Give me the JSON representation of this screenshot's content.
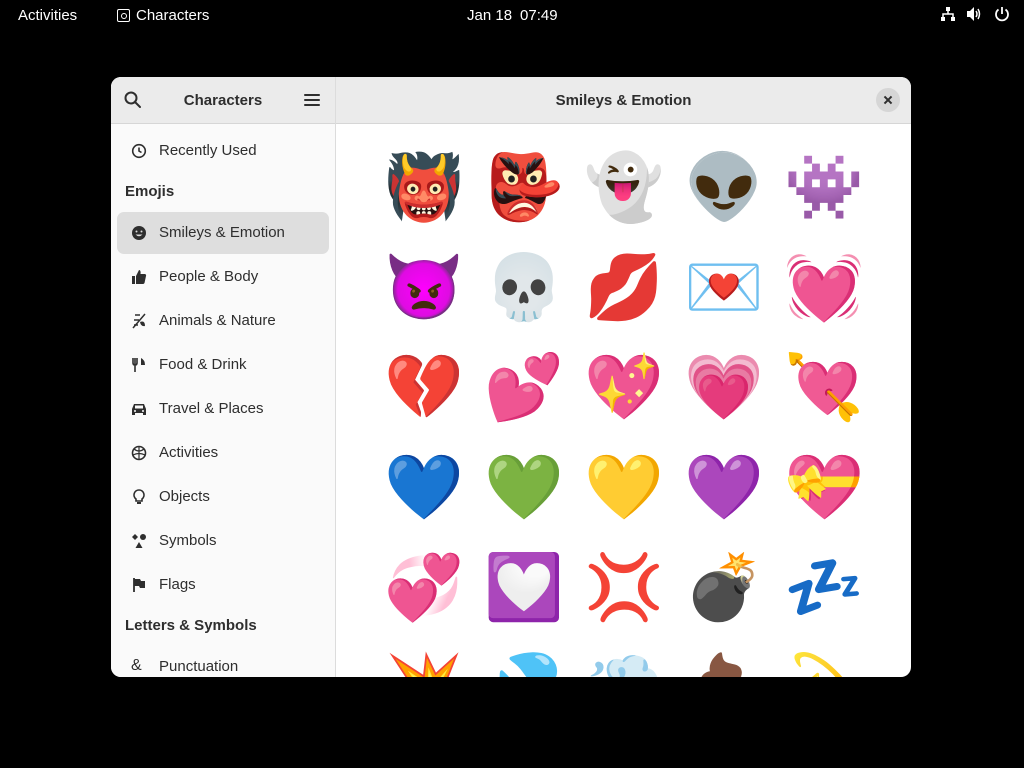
{
  "topbar": {
    "activities": "Activities",
    "app_name": "Characters",
    "date": "Jan 18",
    "time": "07:49",
    "status_icons": [
      "network-icon",
      "volume-icon",
      "power-icon"
    ]
  },
  "sidebar": {
    "title": "Characters",
    "recent": "Recently Used",
    "emojis_heading": "Emojis",
    "items": [
      {
        "label": "Smileys & Emotion",
        "icon": "smiley-icon",
        "active": true
      },
      {
        "label": "People & Body",
        "icon": "thumbs-up-icon"
      },
      {
        "label": "Animals & Nature",
        "icon": "leaf-icon"
      },
      {
        "label": "Food & Drink",
        "icon": "fork-knife-icon"
      },
      {
        "label": "Travel & Places",
        "icon": "car-icon"
      },
      {
        "label": "Activities",
        "icon": "ball-icon"
      },
      {
        "label": "Objects",
        "icon": "lightbulb-icon"
      },
      {
        "label": "Symbols",
        "icon": "symbols-icon"
      },
      {
        "label": "Flags",
        "icon": "flag-icon"
      }
    ],
    "letters_heading": "Letters & Symbols",
    "punctuation": "Punctuation"
  },
  "content": {
    "title": "Smileys & Emotion",
    "emojis": [
      "👹",
      "👺",
      "👻",
      "👽",
      "👾",
      "👿",
      "💀",
      "💋",
      "💌",
      "💓",
      "💔",
      "💕",
      "💖",
      "💗",
      "💘",
      "💙",
      "💚",
      "💛",
      "💜",
      "💝",
      "💞",
      "💟",
      "💢",
      "💣",
      "💤",
      "💥",
      "💦",
      "💨",
      "💩",
      "💫"
    ]
  }
}
